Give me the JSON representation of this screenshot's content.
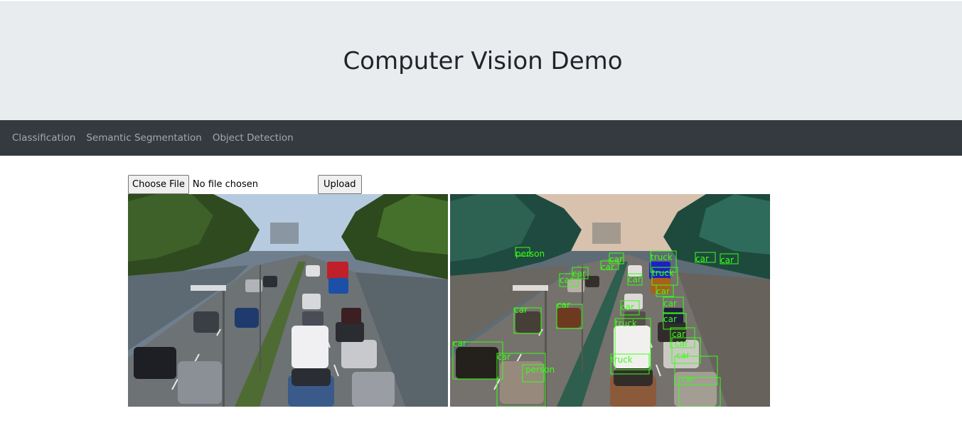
{
  "header": {
    "title": "Computer Vision Demo"
  },
  "nav": {
    "items": [
      {
        "label": "Classification"
      },
      {
        "label": "Semantic Segmentation"
      },
      {
        "label": "Object Detection"
      }
    ]
  },
  "upload": {
    "choose_label": "Choose File",
    "status": "No file chosen",
    "submit_label": "Upload"
  },
  "images": {
    "original": {
      "alt": "Highway traffic photo"
    },
    "detected": {
      "alt": "Highway traffic with detection boxes"
    }
  },
  "detections": [
    {
      "label": "person"
    },
    {
      "label": "car"
    },
    {
      "label": "car"
    },
    {
      "label": "truck"
    },
    {
      "label": "car"
    },
    {
      "label": "car"
    },
    {
      "label": "truck"
    },
    {
      "label": "car"
    },
    {
      "label": "car"
    },
    {
      "label": "car"
    },
    {
      "label": "car"
    },
    {
      "label": "car"
    },
    {
      "label": "car"
    },
    {
      "label": "car"
    },
    {
      "label": "car"
    },
    {
      "label": "truck"
    },
    {
      "label": "car"
    },
    {
      "label": "car"
    },
    {
      "label": "car"
    },
    {
      "label": "truck"
    },
    {
      "label": "car"
    },
    {
      "label": "car"
    },
    {
      "label": "person"
    },
    {
      "label": "car"
    },
    {
      "label": "car"
    }
  ],
  "colors": {
    "box": "#39ff14",
    "truck_box": "#2233ff"
  }
}
